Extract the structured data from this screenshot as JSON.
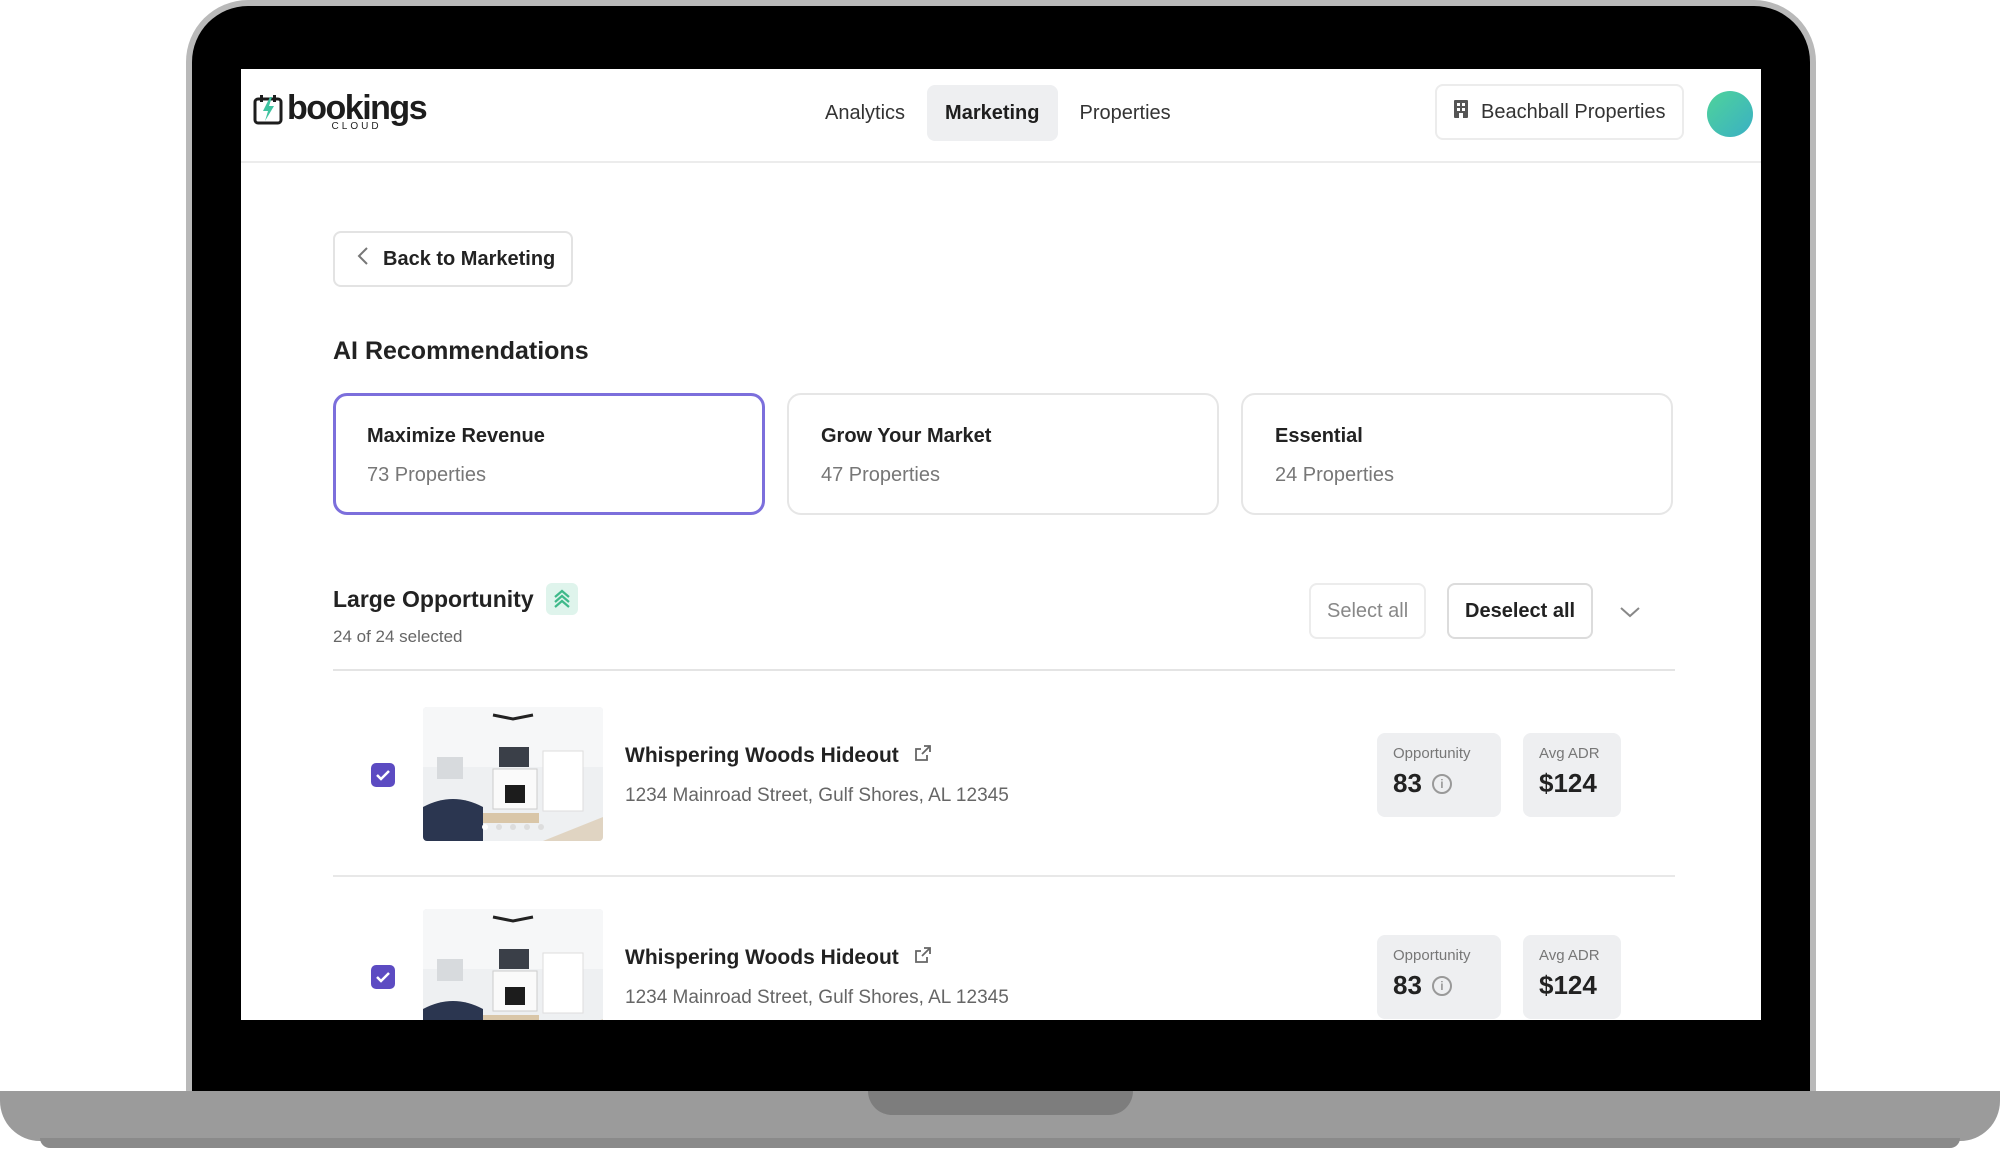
{
  "brand": {
    "name": "bookings",
    "sub": "CLOUD"
  },
  "nav": {
    "tabs": [
      {
        "label": "Analytics",
        "active": false
      },
      {
        "label": "Marketing",
        "active": true
      },
      {
        "label": "Properties",
        "active": false
      }
    ],
    "org_label": "Beachball Properties"
  },
  "back_button": {
    "label": "Back to Marketing"
  },
  "section_title": "AI Recommendations",
  "recommendations": [
    {
      "title": "Maximize Revenue",
      "sub": "73 Properties",
      "active": true
    },
    {
      "title": "Grow Your Market",
      "sub": "47 Properties",
      "active": false
    },
    {
      "title": "Essential",
      "sub": "24 Properties",
      "active": false
    }
  ],
  "group": {
    "title": "Large Opportunity",
    "selected_text": "24 of 24 selected",
    "select_all": "Select all",
    "deselect_all": "Deselect all"
  },
  "properties": [
    {
      "name": "Whispering Woods Hideout",
      "address": "1234 Mainroad Street, Gulf Shores, AL 12345",
      "opportunity_label": "Opportunity",
      "opportunity_value": "83",
      "adr_label": "Avg ADR",
      "adr_value": "$124",
      "checked": true
    },
    {
      "name": "Whispering Woods Hideout",
      "address": "1234 Mainroad Street, Gulf Shores, AL 12345",
      "opportunity_label": "Opportunity",
      "opportunity_value": "83",
      "adr_label": "Avg ADR",
      "adr_value": "$124",
      "checked": true
    }
  ],
  "colors": {
    "accent": "#7c6fdc",
    "checkbox": "#5c4bc2",
    "badge": "#dff4ec",
    "badge_icon": "#3fb98a"
  },
  "icons": {
    "logo": "calendar-lightning-icon",
    "org": "building-icon",
    "back": "chevron-left-icon",
    "group_badge": "chevrons-up-icon",
    "group_toggle": "chevron-down-icon",
    "external": "external-link-icon",
    "info": "info-icon",
    "check": "check-icon"
  }
}
